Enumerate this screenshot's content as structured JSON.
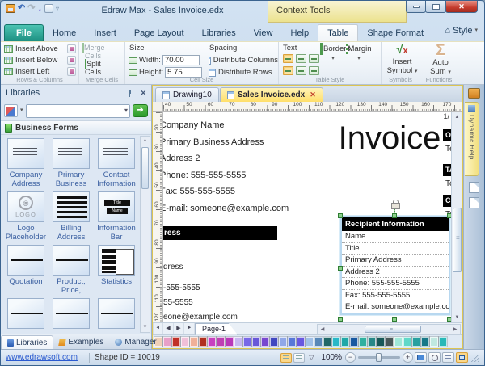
{
  "window": {
    "title": "Edraw Max - Sales Invoice.edx",
    "context_tools_label": "Context Tools"
  },
  "ribbon_tabs": {
    "file": "File",
    "home": "Home",
    "insert": "Insert",
    "page_layout": "Page Layout",
    "libraries": "Libraries",
    "view": "View",
    "help": "Help",
    "table": "Table",
    "shape_format": "Shape Format",
    "style": "Style"
  },
  "icons": {
    "dropdown": "▾",
    "undo": "↶",
    "redo": "↷",
    "down_arrow": "↓",
    "qat_more": "▿",
    "close": "✕",
    "sigma": "Σ",
    "check": "√",
    "x_mark": "x",
    "home": "⌂",
    "left_arrow": "◀",
    "right_arrow": "▶",
    "up_arrow": "▲",
    "down_arrow_small": "▼",
    "go_arrow": "➜",
    "minus": "−",
    "plus": "+",
    "funnel": "▽"
  },
  "ribbon": {
    "rows_columns": {
      "insert_above": "Insert Above",
      "insert_below": "Insert Below",
      "insert_left": "Insert Left",
      "group_label": "Rows & Columns"
    },
    "merge": {
      "merge_cells": "Merge Cells",
      "split_cells": "Split Cells",
      "group_label": "Merge Cells"
    },
    "cell_size": {
      "size_label": "Size",
      "width_label": "Width:",
      "width_value": "70.00",
      "height_label": "Height:",
      "height_value": "5.75",
      "spacing_label": "Spacing",
      "distribute_columns": "Distribute Columns",
      "distribute_rows": "Distribute Rows",
      "group_label": "Cell Size"
    },
    "table_style": {
      "text_label": "Text",
      "borders": "Borders",
      "margin": "Margin",
      "group_label": "Table Style"
    },
    "symbols": {
      "line1": "Insert",
      "line2": "Symbol",
      "group_label": "Symbols"
    },
    "functions": {
      "line1": "Auto",
      "line2": "Sum",
      "group_label": "Functions"
    }
  },
  "libraries_panel": {
    "title": "Libraries",
    "section_header": "Business Forms",
    "items": [
      "Company Address",
      "Primary Business",
      "Contact Information",
      "Logo Placeholder",
      "Billing Address",
      "Information Bar",
      "Quotation",
      "Product, Price,",
      "Statistics"
    ],
    "logo_thumb": {
      "symbol": "®",
      "text": "LOGO"
    },
    "info_bar_thumb": {
      "title": "Title",
      "name": "Name"
    },
    "bottom_tabs": {
      "libraries": "Libraries",
      "examples": "Examples",
      "manager": "Manager"
    }
  },
  "canvas": {
    "doc_tabs": {
      "inactive": "Drawing10",
      "active": "Sales Invoice.edx"
    },
    "ruler_h": [
      "40",
      "50",
      "60",
      "70",
      "80",
      "90",
      "100",
      "110",
      "120",
      "130",
      "140",
      "150",
      "160",
      "170"
    ],
    "ruler_v": [
      "20",
      "30",
      "40",
      "50",
      "60",
      "70",
      "80",
      "90",
      "100",
      "110",
      "120"
    ],
    "page_indicator": "1/",
    "company_block": [
      "Company Name",
      "Primary Business Address",
      "Address 2",
      "Phone: 555-555-5555",
      "Fax: 555-555-5555",
      "E-mail: someone@example.com"
    ],
    "invoice_title": "Invoice",
    "partial_header": "ress",
    "partial_lines": [
      "dress",
      "-555-5555",
      "55-5555",
      "eone@example.com"
    ],
    "cut_boxes": [
      {
        "h": "O",
        "t": "Te"
      },
      {
        "h": "TA",
        "t": "Te"
      },
      {
        "h": "C",
        "t": "Te"
      }
    ],
    "recipient": {
      "header": "Recipient Information",
      "rows": [
        "Name",
        "Title",
        "Primary Address",
        "Address 2",
        "Phone: 555-555-5555",
        "Fax: 555-555-5555",
        "E-mail: someone@example.com"
      ]
    },
    "page_tab": "Page-1"
  },
  "palette": {
    "colors": [
      "#f0d0b8",
      "#e8a0c8",
      "#c03028",
      "#f0c0d8",
      "#f0b098",
      "#b03020",
      "#c840c0",
      "#bf3fb3",
      "#b838b8",
      "#c8b8f0",
      "#7868e8",
      "#6858d8",
      "#7848d0",
      "#4048c0",
      "#90a8e8",
      "#5878d8",
      "#6858e0",
      "#a0c0e8",
      "#5888b8",
      "#206868",
      "#28b8c8",
      "#20a8a8",
      "#1858a0",
      "#30b0a0",
      "#288888",
      "#185858",
      "#485858",
      "#a0e8d8",
      "#60d8c8",
      "#28a0a0",
      "#187888",
      "#c0e8e0",
      "#28b8b8"
    ]
  },
  "right_panel": {
    "tab_label": "Dynamic Help"
  },
  "status_bar": {
    "link": "www.edrawsoft.com",
    "shape_id": "Shape ID = 10019",
    "zoom_level": "100%"
  }
}
